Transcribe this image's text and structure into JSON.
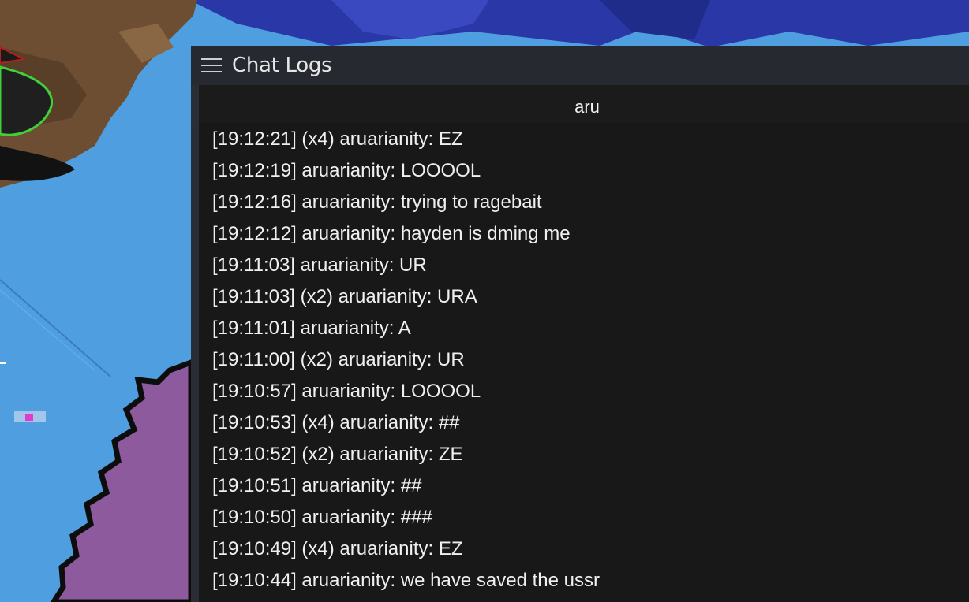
{
  "window": {
    "title": "Chat Logs",
    "menu_icon": "hamburger-menu-icon"
  },
  "filter": {
    "value": "aru"
  },
  "logs": [
    "[19:12:21] (x4) aruarianity: EZ",
    "[19:12:19] aruarianity: LOOOOL",
    "[19:12:16] aruarianity: trying to ragebait",
    "[19:12:12] aruarianity: hayden is dming me",
    "[19:11:03] aruarianity: UR",
    "[19:11:03] (x2) aruarianity: URA",
    "[19:11:01] aruarianity: A",
    "[19:11:00] (x2) aruarianity: UR",
    "[19:10:57] aruarianity: LOOOOL",
    "[19:10:53] (x4) aruarianity: ##",
    "[19:10:52] (x2) aruarianity: ZE",
    "[19:10:51] aruarianity: ##",
    "[19:10:50] aruarianity: ###",
    "[19:10:49] (x4) aruarianity: EZ",
    "[19:10:44] aruarianity: we have saved the ussr"
  ],
  "colors": {
    "panel_bg": "#1b1b1b",
    "titlebar_bg": "#262a30",
    "text": "#f0f0f0"
  }
}
